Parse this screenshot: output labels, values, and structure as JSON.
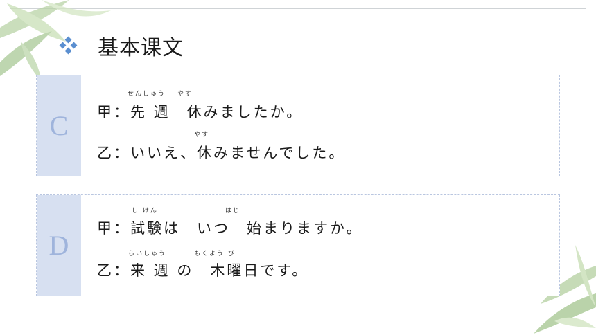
{
  "title": "基本课文",
  "cards": [
    {
      "tag": "C",
      "lines": [
        {
          "text": "甲：先 週　休みましたか。"
        },
        {
          "text": "乙：いいえ、休みませんでした。"
        }
      ],
      "rubies": [
        "せんしゅう",
        "やす",
        "やす"
      ]
    },
    {
      "tag": "D",
      "lines": [
        {
          "text": "甲：試験は　いつ　始まりますか。"
        },
        {
          "text": "乙：来 週 の　木曜日です。"
        }
      ],
      "rubies": [
        "し けん",
        "はじ",
        "らいしゅう",
        "もくよう び"
      ]
    }
  ]
}
